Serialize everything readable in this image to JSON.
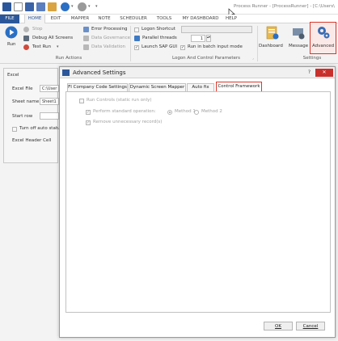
{
  "app": {
    "title": "Process Runner - [ProcessRunner] - [C:\\Users\\"
  },
  "menu": {
    "items": [
      "FILE",
      "HOME",
      "EDIT",
      "MAPPER",
      "NOTE",
      "SCHEDULER",
      "TOOLS",
      "MY DASHBOARD",
      "HELP"
    ],
    "active": "HOME"
  },
  "ribbon": {
    "run": "Run",
    "stop": "Stop",
    "debug": "Debug All Screens",
    "test_run": "Test Run",
    "error_processing": "Error Processing",
    "data_governance": "Data Governance",
    "data_validation": "Data Validation",
    "run_actions_caption": "Run Actions",
    "logon_shortcut": "Logon Shortcut",
    "parallel_threads": "Parallel threads",
    "parallel_value": "1",
    "launch_sap": "Launch SAP GUI",
    "run_batch": "Run in batch input mode",
    "logon_caption": "Logon And Control Parameters",
    "dashboard": "Dashboard",
    "message": "Message",
    "advanced": "Advanced",
    "settings_caption": "Settings"
  },
  "excel_panel": {
    "title": "Excel",
    "excel_file_label": "Excel File",
    "excel_file_value": "C:\\User",
    "sheet_name_label": "Sheet name",
    "sheet_name_value": "Sheet1",
    "start_row_label": "Start row",
    "turn_off_label": "Turn off auto status",
    "header_cell_label": "Excel Header Cell"
  },
  "dialog": {
    "title": "Advanced Settings",
    "help": "?",
    "close": "✕",
    "tabs": [
      "FI Company Code Settings",
      "Dynamic Screen Mapper",
      "Auto fix",
      "Control Framework"
    ],
    "active_tab": "Control Framework",
    "run_controls": "Run Controls (static run only)",
    "perform_standard": "Perform standard operation:",
    "method1": "Method 1",
    "method2": "Method 2",
    "remove_unnecessary": "Remove unnecessary record(s)",
    "ok": "OK",
    "cancel": "Cancel"
  },
  "colors": {
    "accent": "#2b579a",
    "highlight": "#d9372b",
    "close": "#c9302c"
  }
}
